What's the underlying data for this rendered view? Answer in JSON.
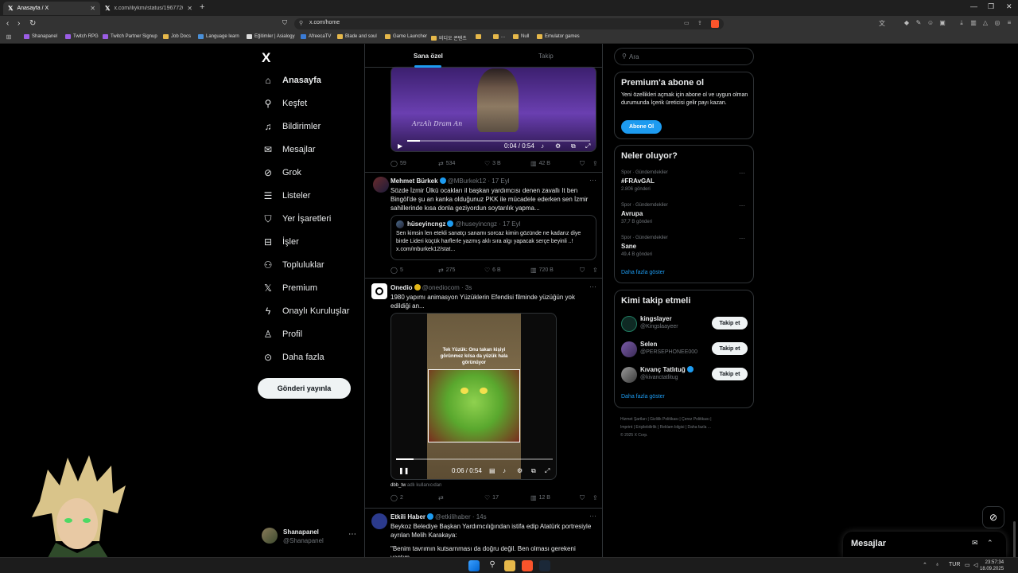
{
  "browser": {
    "tabs": [
      {
        "title": "Anasayfa / X",
        "active": true
      },
      {
        "title": "x.com/iliykmi/status/1967720736324",
        "active": false
      }
    ],
    "url": "x.com/home",
    "bookmarks": [
      "Shanapanel",
      "Twitch RPG",
      "Twitch Partner Signup",
      "Job Docs",
      "Language learn",
      "Eğitimler | Asialogy",
      "AfreecaTV",
      "Blade and soul",
      "Game Launcher",
      "비디오 콘텐츠",
      "",
      "...",
      "Null",
      "Emulator games"
    ]
  },
  "nav": {
    "logo": "X",
    "items": [
      {
        "label": "Anasayfa",
        "icon": "home-icon",
        "active": true
      },
      {
        "label": "Keşfet",
        "icon": "search-icon"
      },
      {
        "label": "Bildirimler",
        "icon": "bell-icon"
      },
      {
        "label": "Mesajlar",
        "icon": "envelope-icon"
      },
      {
        "label": "Grok",
        "icon": "grok-icon"
      },
      {
        "label": "Listeler",
        "icon": "list-icon"
      },
      {
        "label": "Yer İşaretleri",
        "icon": "bookmark-icon"
      },
      {
        "label": "İşler",
        "icon": "briefcase-icon"
      },
      {
        "label": "Topluluklar",
        "icon": "people-icon"
      },
      {
        "label": "Premium",
        "icon": "x-icon"
      },
      {
        "label": "Onaylı Kuruluşlar",
        "icon": "lightning-icon"
      },
      {
        "label": "Profil",
        "icon": "person-icon"
      },
      {
        "label": "Daha fazla",
        "icon": "more-circle-icon"
      }
    ],
    "post_button": "Gönderi yayınla",
    "account": {
      "name": "Shanapanel",
      "handle": "@Shanapanel"
    }
  },
  "feed": {
    "tabs": [
      "Sana özel",
      "Takip"
    ],
    "video1": {
      "time": "0:04 / 0:54",
      "caption": "ArzAlı Dram An",
      "progress": 0.07
    },
    "post0_actions": {
      "replies": "59",
      "reposts": "534",
      "likes": "3 B",
      "views": "42 B"
    },
    "post1": {
      "name": "Mehmet Bürkek",
      "handle": "@MBurkek12 · 17 Eyl",
      "text": "Sözde İzmir Ülkü ocakları il başkan yardımcısı denen zavallı It ben Bingöl'de şu an kanka olduğunuz PKK ile mücadele ederken sen İzmir sahillerinde kısa donla geziyordun soytarılık yapma...",
      "quote": {
        "name": "hüseyincngz",
        "handle": "@huseyincngz · 17 Eyl",
        "text": "Sen kimsin len etekli sanatçı sanamı sorcaz kimin gözünde ne kadarız diye birde Lideri küçük harflerle yazmış aklı sıra algı yapacak serçe beyinli ..! x.com/mburkek12/stat..."
      },
      "actions": {
        "replies": "5",
        "reposts": "275",
        "likes": "6 B",
        "views": "720 B"
      }
    },
    "post2": {
      "name": "Onedio",
      "handle": "@onediocom · 3s",
      "text": "1980 yapımı animasyon Yüzüklerin Efendisi filminde yüzüğün yok edildiği an...",
      "video_caption": "Tek Yüzük: Onu takan kişiyi görünmez kılsa da yüzük hala görünüyor",
      "time": "0:06 / 0:54",
      "progress": 0.11,
      "via_user": "dbb_tw",
      "via_text": "adlı kullanıcıdan",
      "actions": {
        "replies": "2",
        "reposts": "",
        "likes": "17",
        "views": "12 B"
      }
    },
    "post3": {
      "name": "Etkili Haber",
      "handle": "@etkilihaber · 14s",
      "text": "Beykoz Belediye Başkan Yardımcılığından istifa edip Atatürk portresiyle ayrılan Melih Karakaya:",
      "text2": "\"Benim tavrımın kutsarnması da doğru değil. Ben olması gerekeni yaptım."
    }
  },
  "sidebar": {
    "search_placeholder": "Ara",
    "premium": {
      "title": "Premium'a abone ol",
      "body": "Yeni özellikleri açmak için abone ol ve uygun olman durumunda İçerik üreticisi gelir payı kazan.",
      "button": "Abone Ol"
    },
    "trends": {
      "title": "Neler oluyor?",
      "items": [
        {
          "meta": "Spor · Gündemdekiler",
          "name": "#FRAvGAL",
          "count": "2.806 gönderi"
        },
        {
          "meta": "Spor · Gündemdekiler",
          "name": "Avrupa",
          "count": "37,7 B gönderi"
        },
        {
          "meta": "Spor · Gündemdekiler",
          "name": "Sane",
          "count": "49,4 B gönderi"
        }
      ],
      "show_more": "Daha fazla göster"
    },
    "who_to_follow": {
      "title": "Kimi takip etmeli",
      "items": [
        {
          "name": "kingslayer",
          "handle": "@Kingslaayeer",
          "button": "Takip et"
        },
        {
          "name": "Selen",
          "handle": "@PERSEPHONEE000",
          "button": "Takip et"
        },
        {
          "name": "Kıvanç Tatlıtuğ",
          "handle": "@kivanctatlitug",
          "button": "Takip et"
        }
      ],
      "show_more": "Daha fazla göster"
    },
    "footer": [
      "Hizmet Şartları",
      "|",
      "Gizlilik Politikası",
      "|",
      "Çerez Politikası",
      "|",
      "Imprint",
      "|",
      "Erişilebilirlik",
      "|",
      "Reklam bilgisi",
      "|",
      "Daha fazla ...",
      "© 2025 X Corp."
    ],
    "messages_drawer": "Mesajlar"
  },
  "taskbar": {
    "lang": "TUR",
    "time": "23:57:34",
    "date": "18.09.2025"
  }
}
